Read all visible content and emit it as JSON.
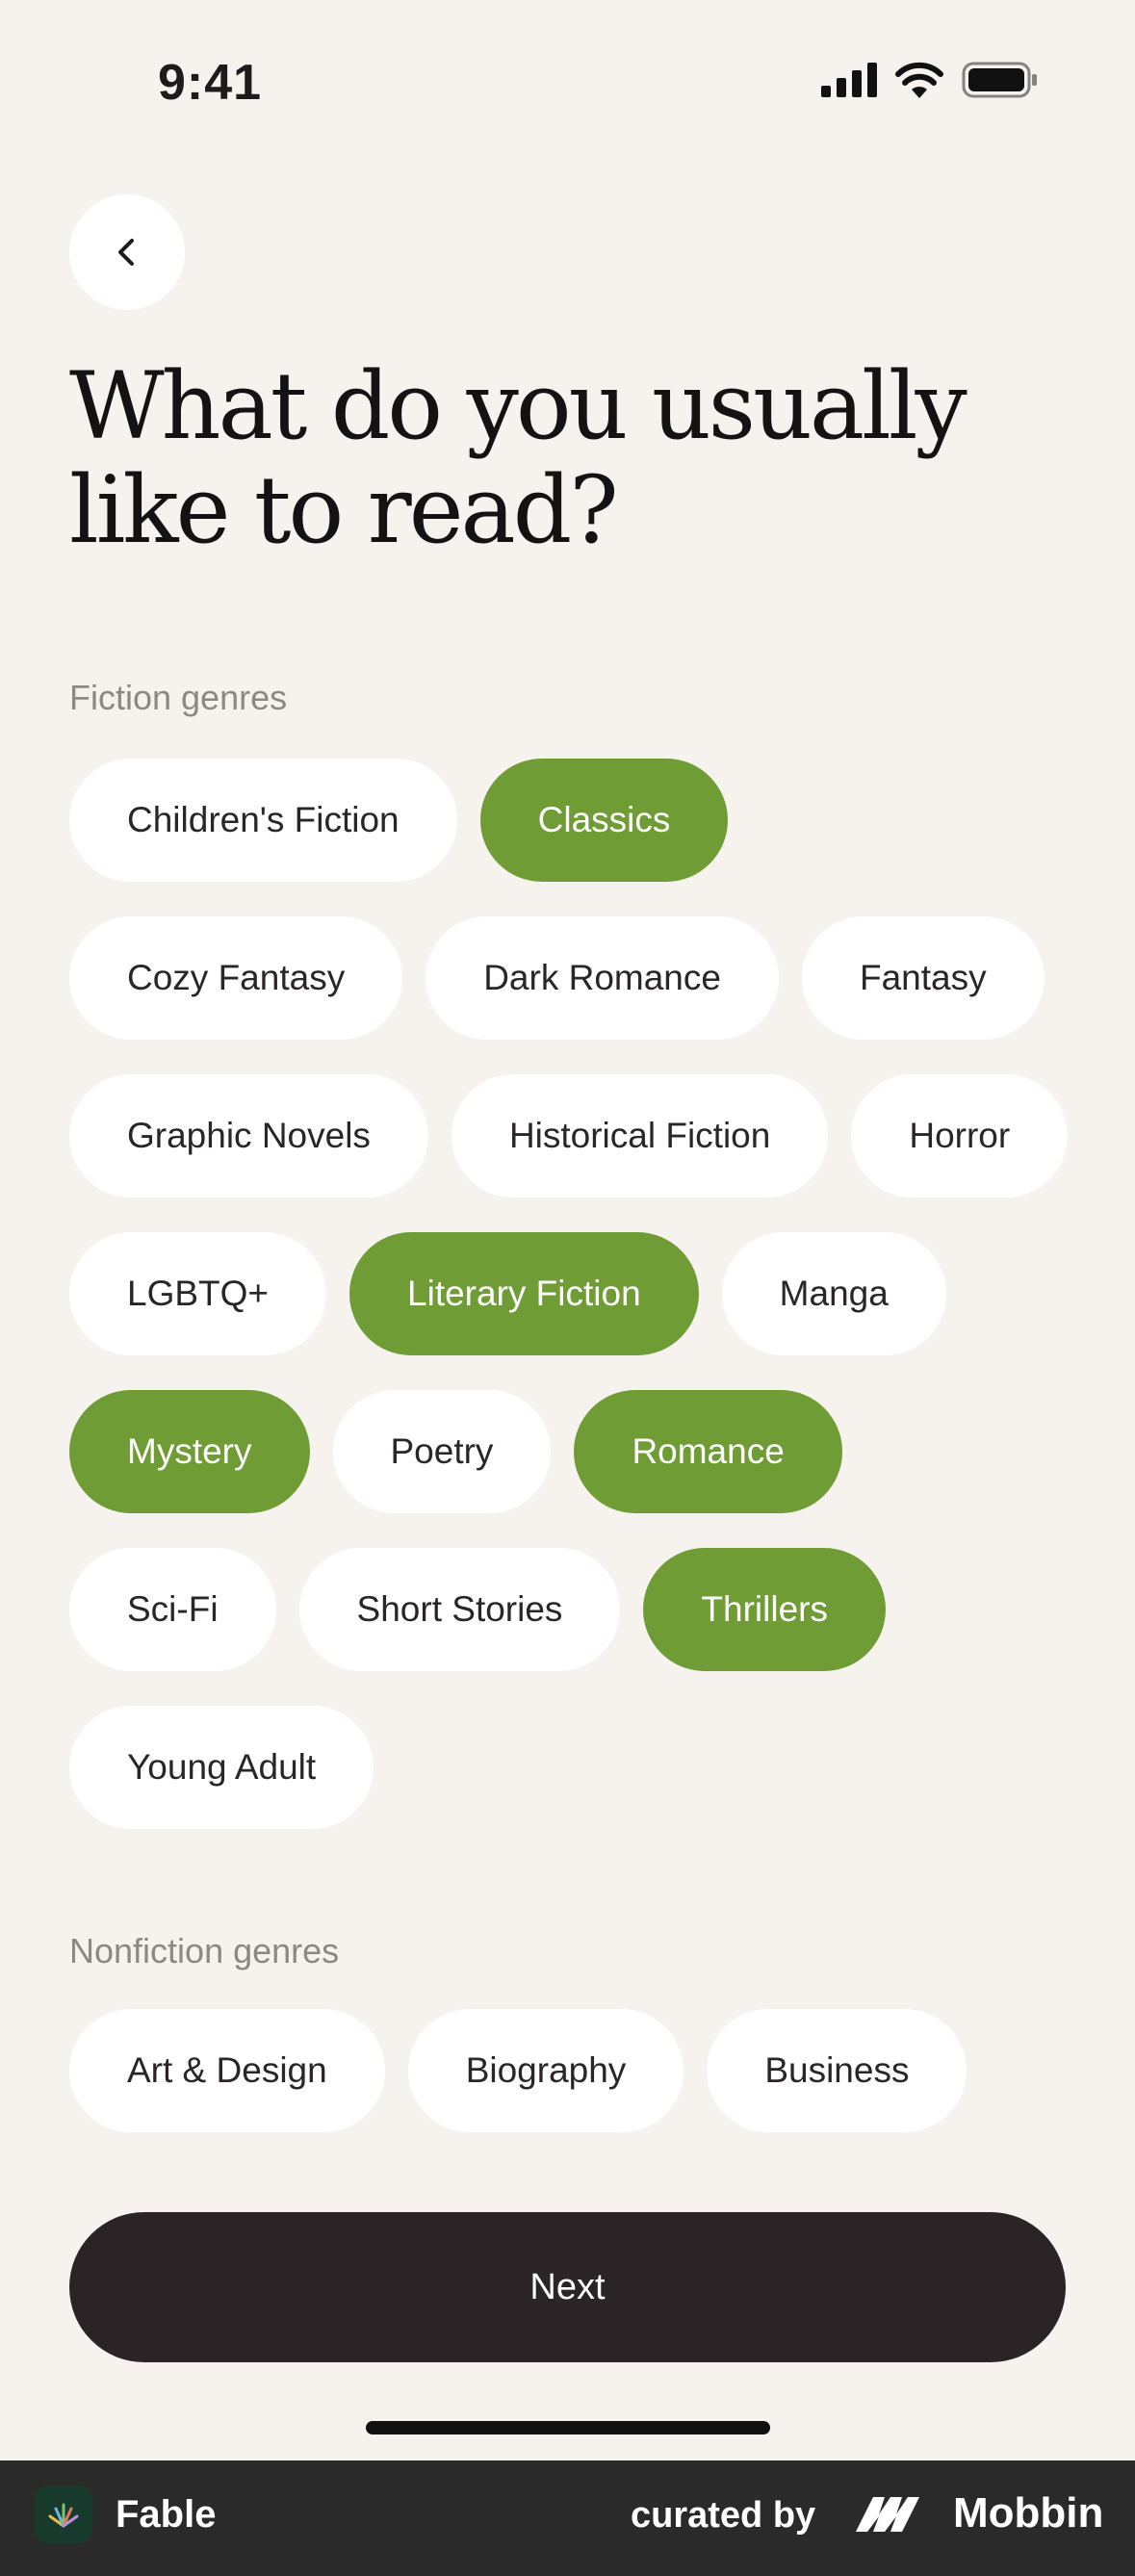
{
  "status": {
    "time": "9:41"
  },
  "page": {
    "title": "What do you usually like to read?"
  },
  "fiction": {
    "label": "Fiction genres",
    "genres": [
      {
        "label": "Children's Fiction",
        "selected": false
      },
      {
        "label": "Classics",
        "selected": true
      },
      {
        "label": "Cozy Fantasy",
        "selected": false
      },
      {
        "label": "Dark Romance",
        "selected": false
      },
      {
        "label": "Fantasy",
        "selected": false
      },
      {
        "label": "Graphic Novels",
        "selected": false
      },
      {
        "label": "Historical Fiction",
        "selected": false
      },
      {
        "label": "Horror",
        "selected": false
      },
      {
        "label": "LGBTQ+",
        "selected": false
      },
      {
        "label": "Literary Fiction",
        "selected": true
      },
      {
        "label": "Manga",
        "selected": false
      },
      {
        "label": "Mystery",
        "selected": true
      },
      {
        "label": "Poetry",
        "selected": false
      },
      {
        "label": "Romance",
        "selected": true
      },
      {
        "label": "Sci-Fi",
        "selected": false
      },
      {
        "label": "Short Stories",
        "selected": false
      },
      {
        "label": "Thrillers",
        "selected": true
      },
      {
        "label": "Young Adult",
        "selected": false
      }
    ]
  },
  "nonfiction": {
    "label": "Nonfiction genres",
    "genres": [
      {
        "label": "Art & Design",
        "selected": false
      },
      {
        "label": "Biography",
        "selected": false
      },
      {
        "label": "Business",
        "selected": false
      }
    ]
  },
  "actions": {
    "next_label": "Next"
  },
  "footer": {
    "app_name": "Fable",
    "curated_by": "curated by",
    "brand": "Mobbin"
  },
  "colors": {
    "background": "#f6f3ee",
    "selected_chip": "#6f9c35",
    "chip": "#ffffff",
    "button": "#2a2427"
  },
  "icons": {
    "back": "chevron-left-icon",
    "signal": "signal-icon",
    "wifi": "wifi-icon",
    "battery": "battery-icon"
  }
}
